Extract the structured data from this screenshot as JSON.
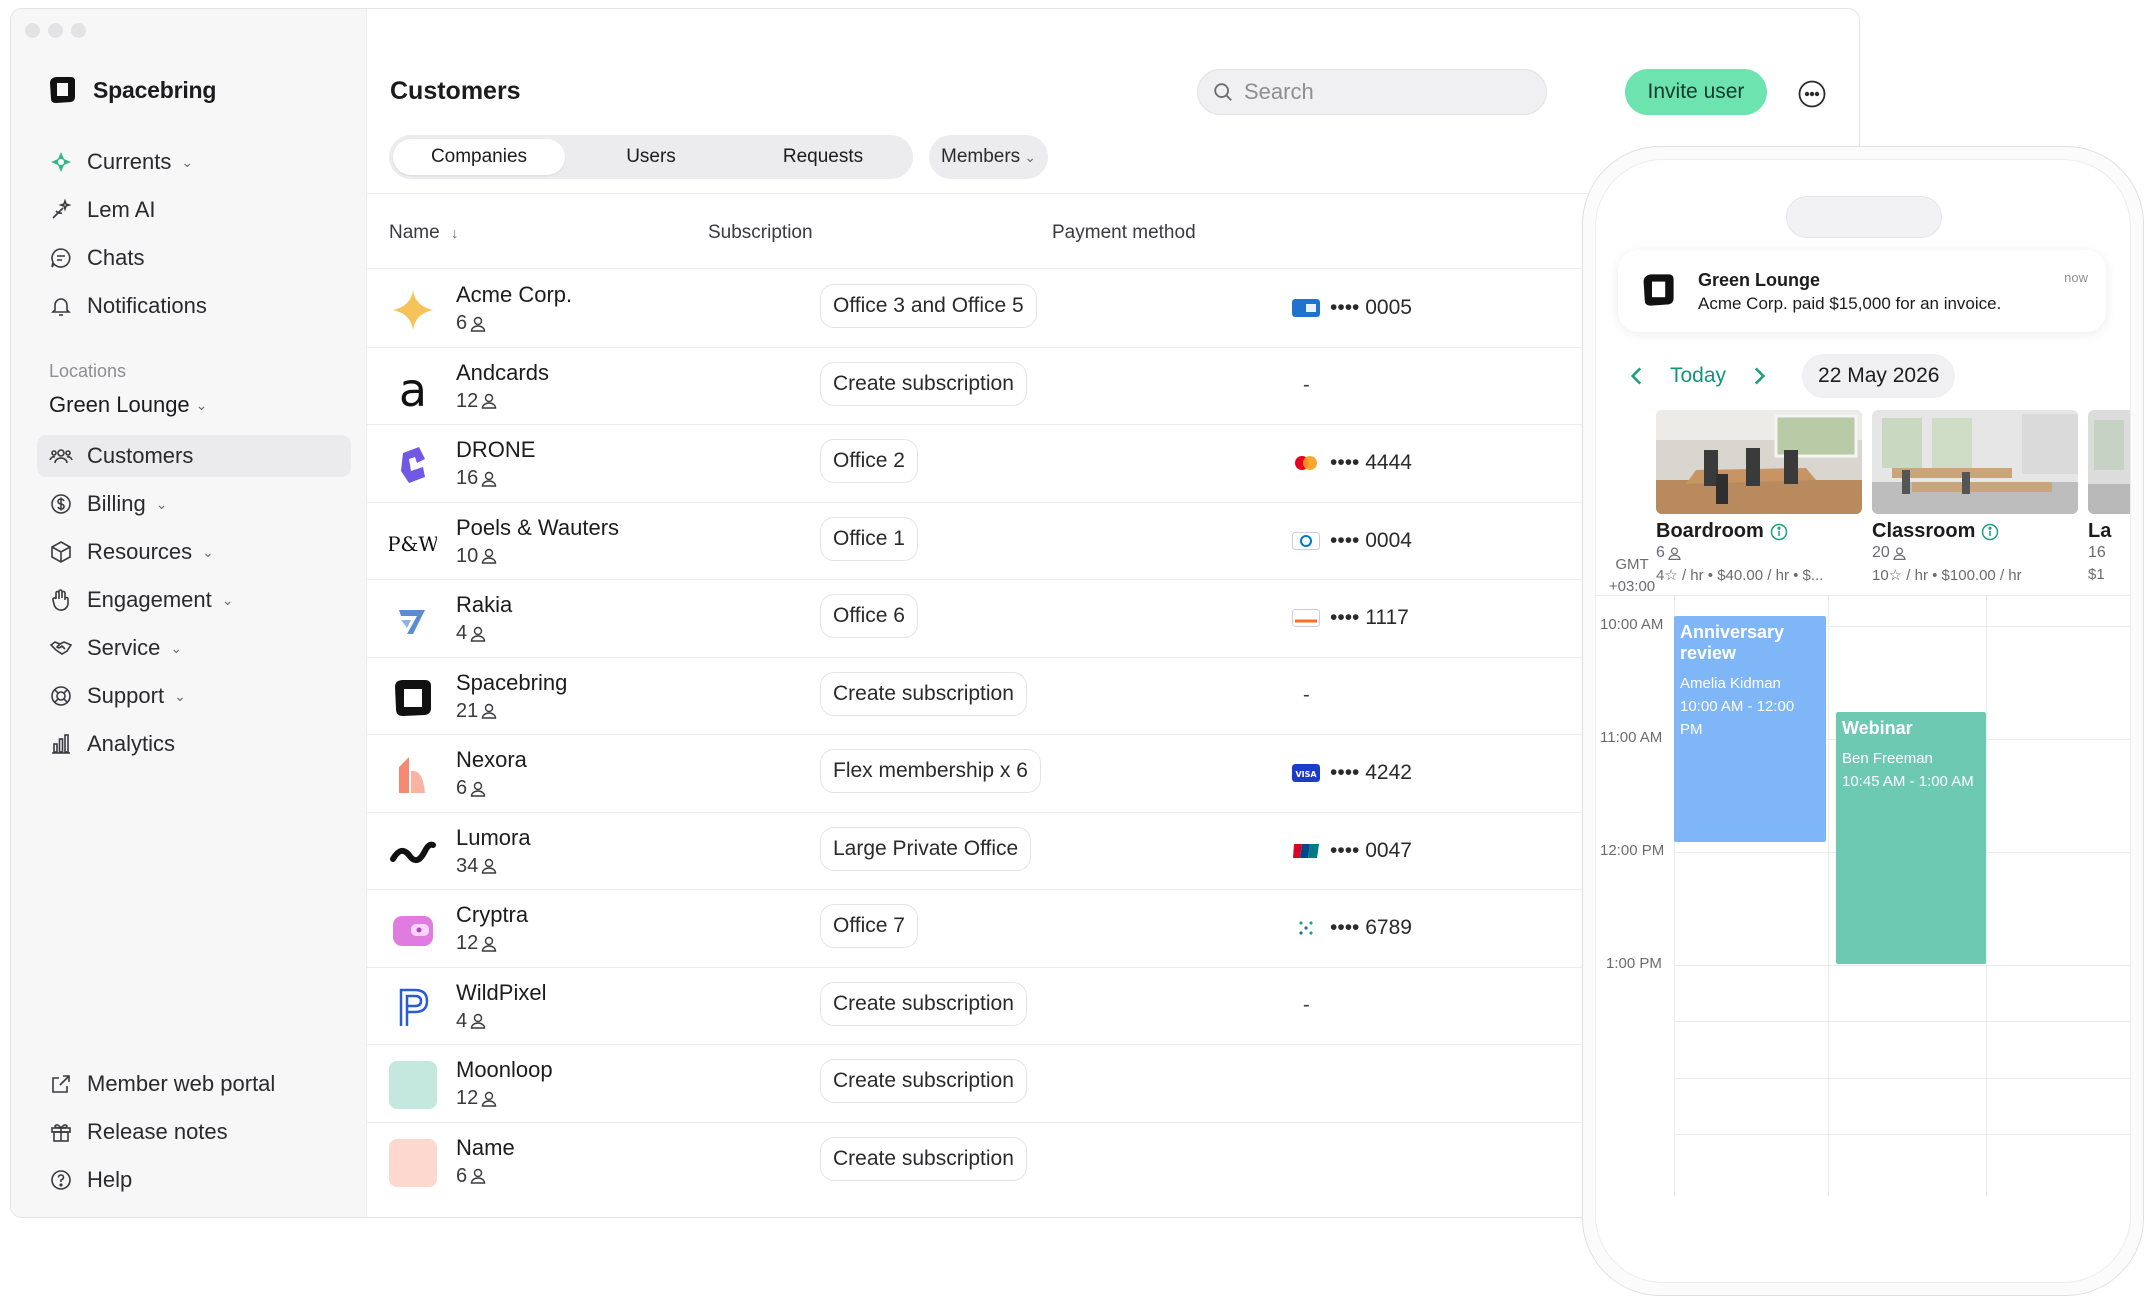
{
  "brand": {
    "name": "Spacebring"
  },
  "nav": {
    "items": [
      {
        "label": "Currents",
        "icon": "currents-icon",
        "dropdown": true
      },
      {
        "label": "Lem AI",
        "icon": "sparkle-icon",
        "dropdown": false
      },
      {
        "label": "Chats",
        "icon": "chat-icon",
        "dropdown": false
      },
      {
        "label": "Notifications",
        "icon": "bell-icon",
        "dropdown": false
      }
    ],
    "locations_label": "Locations",
    "location": "Green Lounge",
    "location_items": [
      {
        "label": "Customers",
        "icon": "users-icon",
        "dropdown": false,
        "active": true
      },
      {
        "label": "Billing",
        "icon": "dollar-icon",
        "dropdown": true
      },
      {
        "label": "Resources",
        "icon": "cube-icon",
        "dropdown": true
      },
      {
        "label": "Engagement",
        "icon": "hand-wave-icon",
        "dropdown": true
      },
      {
        "label": "Service",
        "icon": "handshake-icon",
        "dropdown": true
      },
      {
        "label": "Support",
        "icon": "lifebuoy-icon",
        "dropdown": true
      },
      {
        "label": "Analytics",
        "icon": "bar-chart-icon",
        "dropdown": false
      }
    ],
    "footer_items": [
      {
        "label": "Member web portal",
        "icon": "external-link-icon"
      },
      {
        "label": "Release notes",
        "icon": "gift-icon"
      },
      {
        "label": "Help",
        "icon": "help-circle-icon"
      }
    ]
  },
  "header": {
    "title": "Customers",
    "search_placeholder": "Search",
    "invite_label": "Invite user"
  },
  "tabs": [
    {
      "label": "Companies",
      "active": true
    },
    {
      "label": "Users",
      "active": false
    },
    {
      "label": "Requests",
      "active": false
    }
  ],
  "members_tab": "Members",
  "table": {
    "columns": {
      "name": "Name",
      "subscription": "Subscription",
      "payment": "Payment method"
    },
    "sort_indicator": "↓",
    "rows": [
      {
        "name": "Acme Corp.",
        "count": "6",
        "subscription": "Office 3 and Office 5",
        "payment": "•••• 0005",
        "card": "amex"
      },
      {
        "name": "Andcards",
        "count": "12",
        "subscription": "Create subscription",
        "payment": "-",
        "card": ""
      },
      {
        "name": "DRONE",
        "count": "16",
        "subscription": "Office 2",
        "payment": "•••• 4444",
        "card": "mastercard"
      },
      {
        "name": "Poels & Wauters",
        "count": "10",
        "subscription": "Office 1",
        "payment": "•••• 0004",
        "card": "diners"
      },
      {
        "name": "Rakia",
        "count": "4",
        "subscription": "Office 6",
        "payment": "•••• 1117",
        "card": "discover"
      },
      {
        "name": "Spacebring",
        "count": "21",
        "subscription": "Create subscription",
        "payment": "-",
        "card": ""
      },
      {
        "name": "Nexora",
        "count": "6",
        "subscription": "Flex membership x 6",
        "payment": "•••• 4242",
        "card": "visa"
      },
      {
        "name": "Lumora",
        "count": "34",
        "subscription": "Large Private Office",
        "payment": "•••• 0047",
        "card": "unionpay"
      },
      {
        "name": "Cryptra",
        "count": "12",
        "subscription": "Office 7",
        "payment": "•••• 6789",
        "card": "sepa"
      },
      {
        "name": "WildPixel",
        "count": "4",
        "subscription": "Create subscription",
        "payment": "-",
        "card": ""
      },
      {
        "name": "Moonloop",
        "count": "12",
        "subscription": "Create subscription",
        "payment": "",
        "card": ""
      },
      {
        "name": "Name",
        "count": "6",
        "subscription": "Create subscription",
        "payment": "",
        "card": ""
      }
    ]
  },
  "phone": {
    "notification": {
      "title": "Green Lounge",
      "body": "Acme Corp. paid $15,000 for an invoice.",
      "time": "now"
    },
    "today_label": "Today",
    "date": "22 May 2026",
    "timezone": {
      "line1": "GMT",
      "line2": "+03:00"
    },
    "rooms": [
      {
        "name": "Boardroom",
        "capacity": "6",
        "price": "4☆ / hr • $40.00 / hr • $..."
      },
      {
        "name": "Classroom",
        "capacity": "20",
        "price": "10☆ / hr • $100.00 / hr"
      },
      {
        "name": "La",
        "capacity": "16",
        "price": "$1"
      }
    ],
    "times": [
      "10:00 AM",
      "11:00 AM",
      "12:00 PM",
      "1:00 PM"
    ],
    "events": [
      {
        "title": "Anniversary review",
        "person": "Amelia Kidman",
        "time": "10:00 AM - 12:00 PM",
        "color": "#7fb6f7"
      },
      {
        "title": "Webinar",
        "person": "Ben Freeman",
        "time": "10:45 AM - 1:00 AM",
        "color": "#6ec9b3"
      }
    ]
  },
  "colors": {
    "accent": "#6de3b0",
    "link": "#13957a",
    "sidebar_bg": "#f7f7f8"
  }
}
